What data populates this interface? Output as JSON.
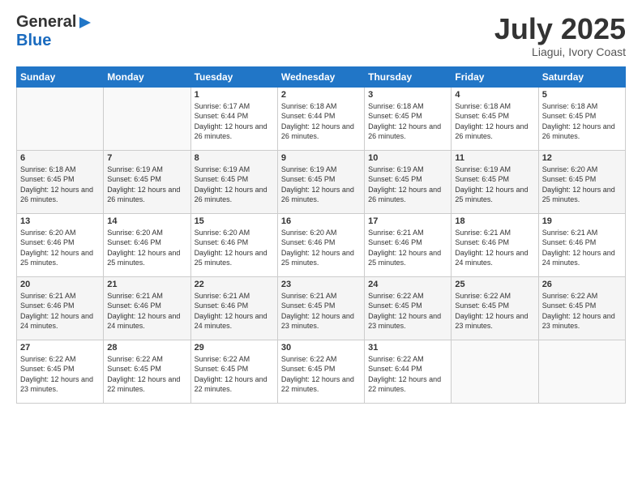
{
  "logo": {
    "general": "General",
    "blue": "Blue"
  },
  "title": "July 2025",
  "location": "Liagui, Ivory Coast",
  "days_header": [
    "Sunday",
    "Monday",
    "Tuesday",
    "Wednesday",
    "Thursday",
    "Friday",
    "Saturday"
  ],
  "weeks": [
    [
      {
        "day": "",
        "info": ""
      },
      {
        "day": "",
        "info": ""
      },
      {
        "day": "1",
        "info": "Sunrise: 6:17 AM\nSunset: 6:44 PM\nDaylight: 12 hours and 26 minutes."
      },
      {
        "day": "2",
        "info": "Sunrise: 6:18 AM\nSunset: 6:44 PM\nDaylight: 12 hours and 26 minutes."
      },
      {
        "day": "3",
        "info": "Sunrise: 6:18 AM\nSunset: 6:45 PM\nDaylight: 12 hours and 26 minutes."
      },
      {
        "day": "4",
        "info": "Sunrise: 6:18 AM\nSunset: 6:45 PM\nDaylight: 12 hours and 26 minutes."
      },
      {
        "day": "5",
        "info": "Sunrise: 6:18 AM\nSunset: 6:45 PM\nDaylight: 12 hours and 26 minutes."
      }
    ],
    [
      {
        "day": "6",
        "info": "Sunrise: 6:18 AM\nSunset: 6:45 PM\nDaylight: 12 hours and 26 minutes."
      },
      {
        "day": "7",
        "info": "Sunrise: 6:19 AM\nSunset: 6:45 PM\nDaylight: 12 hours and 26 minutes."
      },
      {
        "day": "8",
        "info": "Sunrise: 6:19 AM\nSunset: 6:45 PM\nDaylight: 12 hours and 26 minutes."
      },
      {
        "day": "9",
        "info": "Sunrise: 6:19 AM\nSunset: 6:45 PM\nDaylight: 12 hours and 26 minutes."
      },
      {
        "day": "10",
        "info": "Sunrise: 6:19 AM\nSunset: 6:45 PM\nDaylight: 12 hours and 26 minutes."
      },
      {
        "day": "11",
        "info": "Sunrise: 6:19 AM\nSunset: 6:45 PM\nDaylight: 12 hours and 25 minutes."
      },
      {
        "day": "12",
        "info": "Sunrise: 6:20 AM\nSunset: 6:45 PM\nDaylight: 12 hours and 25 minutes."
      }
    ],
    [
      {
        "day": "13",
        "info": "Sunrise: 6:20 AM\nSunset: 6:46 PM\nDaylight: 12 hours and 25 minutes."
      },
      {
        "day": "14",
        "info": "Sunrise: 6:20 AM\nSunset: 6:46 PM\nDaylight: 12 hours and 25 minutes."
      },
      {
        "day": "15",
        "info": "Sunrise: 6:20 AM\nSunset: 6:46 PM\nDaylight: 12 hours and 25 minutes."
      },
      {
        "day": "16",
        "info": "Sunrise: 6:20 AM\nSunset: 6:46 PM\nDaylight: 12 hours and 25 minutes."
      },
      {
        "day": "17",
        "info": "Sunrise: 6:21 AM\nSunset: 6:46 PM\nDaylight: 12 hours and 25 minutes."
      },
      {
        "day": "18",
        "info": "Sunrise: 6:21 AM\nSunset: 6:46 PM\nDaylight: 12 hours and 24 minutes."
      },
      {
        "day": "19",
        "info": "Sunrise: 6:21 AM\nSunset: 6:46 PM\nDaylight: 12 hours and 24 minutes."
      }
    ],
    [
      {
        "day": "20",
        "info": "Sunrise: 6:21 AM\nSunset: 6:46 PM\nDaylight: 12 hours and 24 minutes."
      },
      {
        "day": "21",
        "info": "Sunrise: 6:21 AM\nSunset: 6:46 PM\nDaylight: 12 hours and 24 minutes."
      },
      {
        "day": "22",
        "info": "Sunrise: 6:21 AM\nSunset: 6:46 PM\nDaylight: 12 hours and 24 minutes."
      },
      {
        "day": "23",
        "info": "Sunrise: 6:21 AM\nSunset: 6:45 PM\nDaylight: 12 hours and 23 minutes."
      },
      {
        "day": "24",
        "info": "Sunrise: 6:22 AM\nSunset: 6:45 PM\nDaylight: 12 hours and 23 minutes."
      },
      {
        "day": "25",
        "info": "Sunrise: 6:22 AM\nSunset: 6:45 PM\nDaylight: 12 hours and 23 minutes."
      },
      {
        "day": "26",
        "info": "Sunrise: 6:22 AM\nSunset: 6:45 PM\nDaylight: 12 hours and 23 minutes."
      }
    ],
    [
      {
        "day": "27",
        "info": "Sunrise: 6:22 AM\nSunset: 6:45 PM\nDaylight: 12 hours and 23 minutes."
      },
      {
        "day": "28",
        "info": "Sunrise: 6:22 AM\nSunset: 6:45 PM\nDaylight: 12 hours and 22 minutes."
      },
      {
        "day": "29",
        "info": "Sunrise: 6:22 AM\nSunset: 6:45 PM\nDaylight: 12 hours and 22 minutes."
      },
      {
        "day": "30",
        "info": "Sunrise: 6:22 AM\nSunset: 6:45 PM\nDaylight: 12 hours and 22 minutes."
      },
      {
        "day": "31",
        "info": "Sunrise: 6:22 AM\nSunset: 6:44 PM\nDaylight: 12 hours and 22 minutes."
      },
      {
        "day": "",
        "info": ""
      },
      {
        "day": "",
        "info": ""
      }
    ]
  ]
}
